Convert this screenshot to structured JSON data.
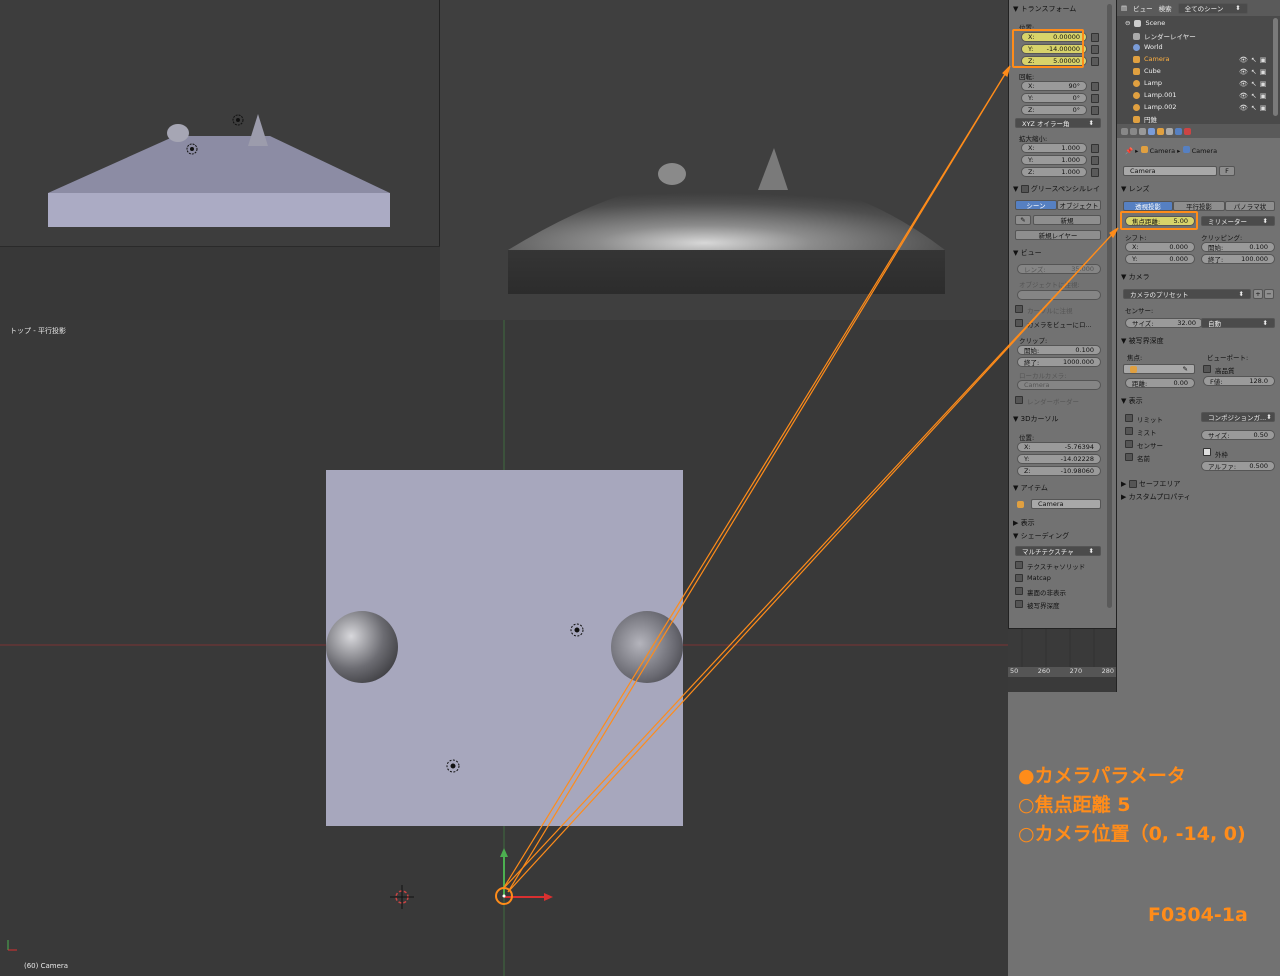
{
  "main_viewport": {
    "header": "トップ - 平行投影",
    "footer": "(60) Camera"
  },
  "n_panel": {
    "transform": {
      "title": "トランスフォーム",
      "location_label": "位置:",
      "location": [
        {
          "axis": "X:",
          "value": "0.00000"
        },
        {
          "axis": "Y:",
          "value": "-14.00000"
        },
        {
          "axis": "Z:",
          "value": "5.00000"
        }
      ],
      "rotation_label": "回転:",
      "rotation": [
        {
          "axis": "X:",
          "value": "90°"
        },
        {
          "axis": "Y:",
          "value": "0°"
        },
        {
          "axis": "Z:",
          "value": "0°"
        }
      ],
      "rotation_mode": "XYZ オイラー角",
      "scale_label": "拡大縮小:",
      "scale": [
        {
          "axis": "X:",
          "value": "1.000"
        },
        {
          "axis": "Y:",
          "value": "1.000"
        },
        {
          "axis": "Z:",
          "value": "1.000"
        }
      ]
    },
    "grease": {
      "title": "グリースペンシルレイ",
      "tab_scene": "シーン",
      "tab_object": "オブジェクト",
      "new": "新規",
      "new_layer": "新規レイヤー"
    },
    "view": {
      "title": "ビュー",
      "lens_label": "レンズ:",
      "lens_value": "35.000",
      "lock_to_object": "オブジェクトに注視:",
      "lock_cursor": "カーソルに注視",
      "lock_camera": "カメラをビューにロ...",
      "clip_label": "クリップ:",
      "clip_start_label": "開始:",
      "clip_start": "0.100",
      "clip_end_label": "終了:",
      "clip_end": "1000.000",
      "local_camera": "ローカルカメラ:",
      "local_camera_value": "Camera",
      "render_border": "レンダーボーダー"
    },
    "cursor": {
      "title": "3Dカーソル",
      "location_label": "位置:",
      "location": [
        {
          "axis": "X:",
          "value": "-5.76394"
        },
        {
          "axis": "Y:",
          "value": "-14.02228"
        },
        {
          "axis": "Z:",
          "value": "-10.98060"
        }
      ]
    },
    "item": {
      "title": "アイテム",
      "name": "Camera"
    },
    "display": {
      "title": "表示"
    },
    "shading": {
      "title": "シェーディング",
      "mode": "マルチテクスチャ",
      "options": [
        "テクスチャソリッド",
        "Matcap",
        "裏面の非表示",
        "被写界深度"
      ]
    }
  },
  "timeline": {
    "ticks": [
      "50",
      "260",
      "270",
      "280"
    ]
  },
  "outliner": {
    "menu_view": "ビュー",
    "menu_search": "検索",
    "scene_filter": "全てのシーン",
    "items": [
      {
        "label": "Scene",
        "color": "#cccccc"
      },
      {
        "label": "レンダーレイヤー",
        "color": "#aaaaaa"
      },
      {
        "label": "World",
        "color": "#7a9cd8"
      },
      {
        "label": "Camera",
        "color": "#e0a040"
      },
      {
        "label": "Cube",
        "color": "#e0a040"
      },
      {
        "label": "Lamp",
        "color": "#e0a040"
      },
      {
        "label": "Lamp.001",
        "color": "#e0a040"
      },
      {
        "label": "Lamp.002",
        "color": "#e0a040"
      },
      {
        "label": "円錐",
        "color": "#e0a040"
      }
    ]
  },
  "properties": {
    "breadcrumb": [
      "Camera",
      "Camera"
    ],
    "datablock": "Camera",
    "datablock_flag": "F",
    "lens": {
      "title": "レンズ",
      "tab_persp": "透視投影",
      "tab_ortho": "平行投影",
      "tab_pano": "パノラマ状",
      "focal_label": "焦点距離:",
      "focal_value": "5.00",
      "unit": "ミリメーター",
      "shift_label": "シフト:",
      "shift_x_label": "X:",
      "shift_x": "0.000",
      "shift_y_label": "Y:",
      "shift_y": "0.000",
      "clip_label": "クリッピング:",
      "clip_start_label": "開始:",
      "clip_start": "0.100",
      "clip_end_label": "終了:",
      "clip_end": "100.000"
    },
    "camera": {
      "title": "カメラ",
      "presets": "カメラのプリセット",
      "sensor_label": "センサー:",
      "size_label": "サイズ:",
      "size_value": "32.00",
      "fit": "自動"
    },
    "dof": {
      "title": "被写界深度",
      "focus_label": "焦点:",
      "viewport_label": "ビューポート:",
      "distance_label": "距離:",
      "distance_value": "0.00",
      "hq": "高品質",
      "fstop_label": "F値:",
      "fstop_value": "128.0"
    },
    "display": {
      "title": "表示",
      "limits": "リミット",
      "mist": "ミスト",
      "sensor": "センサー",
      "name": "名前",
      "composition": "コンポジションガ...",
      "size_label": "サイズ:",
      "size_value": "0.50",
      "passepartout": "外枠",
      "alpha_label": "アルファ:",
      "alpha_value": "0.500"
    },
    "safe_areas": "セーフエリア",
    "custom_props": "カスタムプロパティ"
  },
  "annotation": {
    "line1": "●カメラパラメータ",
    "line2": "○焦点距離 5",
    "line3": "○カメラ位置（0, -14, 0)",
    "figure_id": "F0304-1a"
  },
  "colors": {
    "accent": "#ff8c1a",
    "x_axis": "#d93030",
    "y_axis": "#4caf50",
    "blender_gray": "#727272"
  }
}
